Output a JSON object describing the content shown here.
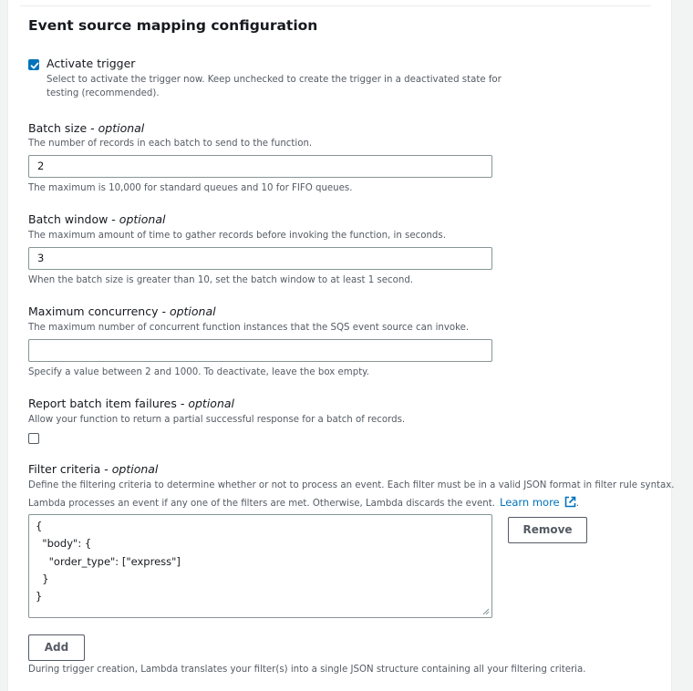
{
  "section": {
    "title": "Event source mapping configuration"
  },
  "activate_trigger": {
    "checked": true,
    "label": "Activate trigger",
    "desc_line1": "Select to activate the trigger now. Keep unchecked to create the trigger in a deactivated state for",
    "desc_line2": "testing (recommended)."
  },
  "batch_size": {
    "label": "Batch size - ",
    "optional": "optional",
    "desc": "The number of records in each batch to send to the function.",
    "value": "2",
    "hint": "The maximum is 10,000 for standard queues and 10 for FIFO queues."
  },
  "batch_window": {
    "label": "Batch window - ",
    "optional": "optional",
    "desc": "The maximum amount of time to gather records before invoking the function, in seconds.",
    "value": "3",
    "hint": "When the batch size is greater than 10, set the batch window to at least 1 second."
  },
  "max_concurrency": {
    "label": "Maximum concurrency - ",
    "optional": "optional",
    "desc": "The maximum number of concurrent function instances that the SQS event source can invoke.",
    "value": "",
    "hint": "Specify a value between 2 and 1000. To deactivate, leave the box empty."
  },
  "report_failures": {
    "checked": false,
    "label": "Report batch item failures - ",
    "optional": "optional",
    "desc": "Allow your function to return a partial successful response for a batch of records."
  },
  "filter_criteria": {
    "label": "Filter criteria - ",
    "optional": "optional",
    "desc_line1": "Define the filtering criteria to determine whether or not to process an event. Each filter must be in a valid JSON format in filter rule syntax.",
    "desc_line2": "Lambda processes an event if any one of the filters are met. Otherwise, Lambda discards the event.",
    "learn_more": "Learn more",
    "period": ".",
    "code_lines": [
      "{",
      "  \"body\": {",
      "    \"order_type\": [\"express\"]",
      "  }",
      "}"
    ],
    "remove_label": "Remove",
    "add_label": "Add",
    "footer": "During trigger creation, Lambda translates your filter(s) into a single JSON structure containing all your filtering criteria."
  },
  "colors": {
    "accent": "#0073bb",
    "text": "#16191f",
    "muted": "#545b64",
    "border": "#879596"
  }
}
